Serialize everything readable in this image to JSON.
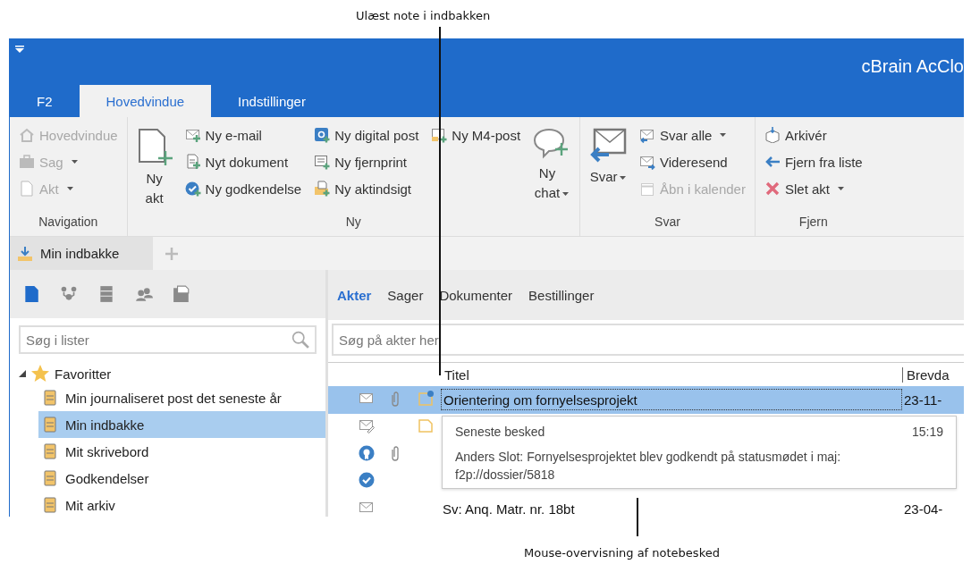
{
  "annotations": [
    {
      "text": "Ulæst note i indbakken"
    },
    {
      "text": "Mouse-overvisning af notebesked"
    }
  ],
  "window": {
    "title": "cBrain AcClo"
  },
  "ribbon_tabs": [
    {
      "label": "F2",
      "selected": false
    },
    {
      "label": "Hovedvindue",
      "selected": true
    },
    {
      "label": "Indstillinger",
      "selected": false
    }
  ],
  "ribbon_groups": [
    {
      "label": "Navigation",
      "columns": [
        {
          "kind": "stack",
          "items": [
            {
              "label": "Hovedvindue",
              "disabled": true,
              "dropdown": false
            },
            {
              "label": "Sag",
              "disabled": true,
              "dropdown": true
            },
            {
              "label": "Akt",
              "disabled": true,
              "dropdown": true
            }
          ]
        }
      ]
    },
    {
      "label": "Ny",
      "columns": [
        {
          "kind": "large",
          "label": "Ny akt",
          "dropdown": false
        },
        {
          "kind": "stack",
          "items": [
            {
              "label": "Ny e-mail",
              "disabled": false,
              "dropdown": false
            },
            {
              "label": "Nyt dokument",
              "disabled": false,
              "dropdown": false
            },
            {
              "label": "Ny godkendelse",
              "disabled": false,
              "dropdown": false
            }
          ]
        },
        {
          "kind": "stack",
          "items": [
            {
              "label": "Ny digital post",
              "disabled": false,
              "dropdown": false
            },
            {
              "label": "Ny fjernprint",
              "disabled": false,
              "dropdown": false
            },
            {
              "label": "Ny aktindsigt",
              "disabled": false,
              "dropdown": false
            }
          ]
        },
        {
          "kind": "stack",
          "items": [
            {
              "label": "Ny M4-post",
              "disabled": false,
              "dropdown": false
            }
          ]
        },
        {
          "kind": "large",
          "label": "Ny chat",
          "dropdown": true
        }
      ]
    },
    {
      "label": "Svar",
      "columns": [
        {
          "kind": "large",
          "label": "Svar",
          "dropdown": true
        },
        {
          "kind": "stack",
          "items": [
            {
              "label": "Svar alle",
              "disabled": false,
              "dropdown": true
            },
            {
              "label": "Videresend",
              "disabled": false,
              "dropdown": false
            },
            {
              "label": "Åbn i kalender",
              "disabled": true,
              "dropdown": false
            }
          ]
        }
      ]
    },
    {
      "label": "Fjern",
      "columns": [
        {
          "kind": "stack",
          "items": [
            {
              "label": "Arkivér",
              "disabled": false,
              "dropdown": false
            },
            {
              "label": "Fjern fra liste",
              "disabled": false,
              "dropdown": false
            },
            {
              "label": "Slet akt",
              "disabled": false,
              "dropdown": true
            }
          ]
        }
      ]
    }
  ],
  "doc_tabs": [
    {
      "label": "Min indbakke",
      "selected": true
    }
  ],
  "sidebar_views": [
    {
      "selected": true
    },
    {
      "selected": false
    },
    {
      "selected": false
    },
    {
      "selected": false
    },
    {
      "selected": false
    }
  ],
  "sidebar_search": {
    "placeholder": "Søg i lister"
  },
  "tree": [
    {
      "label": "Favoritter",
      "expanded": true,
      "children": [
        {
          "label": "Min journaliseret post det seneste år",
          "selected": false
        },
        {
          "label": "Min indbakke",
          "selected": true
        },
        {
          "label": "Mit skrivebord",
          "selected": false
        },
        {
          "label": "Godkendelser",
          "selected": false
        },
        {
          "label": "Mit arkiv",
          "selected": false
        }
      ]
    }
  ],
  "list_tabs": [
    {
      "label": "Akter",
      "selected": true
    },
    {
      "label": "Sager",
      "selected": false
    },
    {
      "label": "Dokumenter",
      "selected": false
    },
    {
      "label": "Bestillinger",
      "selected": false
    }
  ],
  "list_search": {
    "placeholder": "Søg på akter her"
  },
  "table": {
    "columns": [
      "Titel",
      "Brevda"
    ],
    "rows": [
      {
        "kind": "email",
        "attachment": true,
        "note": true,
        "unread": true,
        "selected": true,
        "title": "Orientering om fornyelsesprojekt",
        "date": "23-11-"
      },
      {
        "kind": "draft",
        "attachment": false,
        "note": true,
        "unread": false,
        "selected": false
      },
      {
        "kind": "certificate",
        "attachment": true,
        "note": false,
        "selected": false
      },
      {
        "kind": "approval",
        "attachment": false,
        "note": false,
        "selected": false
      },
      {
        "kind": "email",
        "attachment": false,
        "note": false,
        "selected": false,
        "title": "Sv: Anq. Matr. nr. 18bt",
        "date": "23-04-"
      }
    ]
  },
  "tooltip": {
    "heading": "Seneste besked",
    "time": "15:19",
    "body": "Anders Slot: Fornyelsesprojektet blev godkendt på statusmødet i maj: f2p://dossier/5818"
  }
}
